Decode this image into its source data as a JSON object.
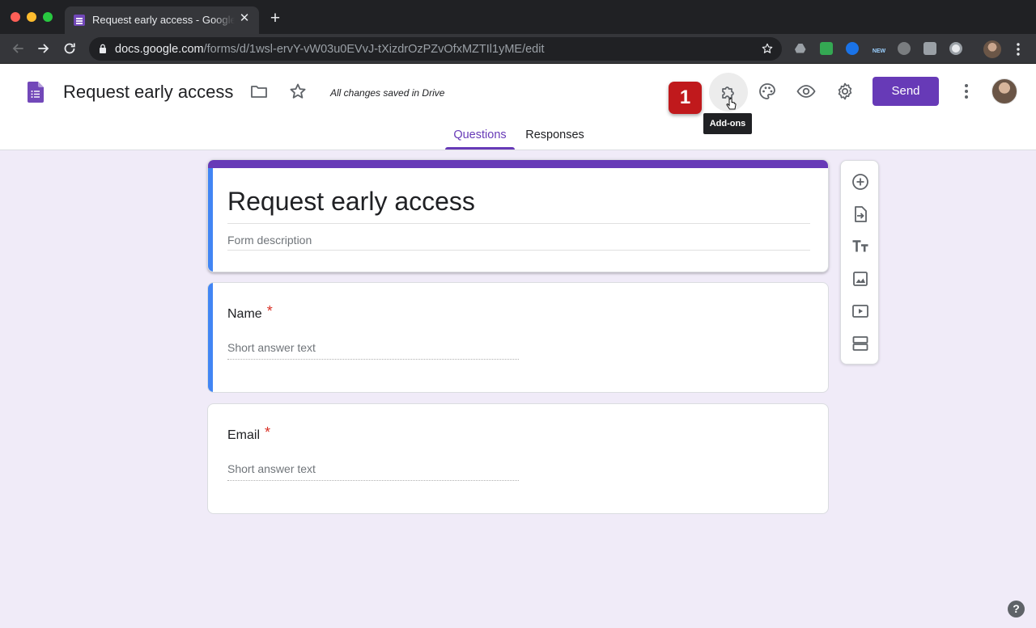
{
  "browser": {
    "tab_title": "Request early access - Google Forms",
    "tab_close_glyph": "✕",
    "new_tab_glyph": "+",
    "url_host": "docs.google.com",
    "url_path": "/forms/d/1wsl-ervY-vW03u0EVvJ-tXizdrOzPZvOfxMZTIl1yME/edit",
    "extension_badge_new": "NEW"
  },
  "header": {
    "doc_title": "Request early access",
    "save_status": "All changes saved in Drive",
    "step_badge": "1",
    "addons_tooltip": "Add-ons",
    "send_label": "Send",
    "tabs": [
      {
        "label": "Questions",
        "active": true
      },
      {
        "label": "Responses",
        "active": false
      }
    ]
  },
  "form": {
    "title": "Request early access",
    "description_placeholder": "Form description",
    "questions": [
      {
        "label": "Name",
        "required_mark": "*",
        "answer_placeholder": "Short answer text"
      },
      {
        "label": "Email",
        "required_mark": "*",
        "answer_placeholder": "Short answer text"
      }
    ]
  },
  "sidebar_tools": [
    "add-question-icon",
    "import-questions-icon",
    "add-title-icon",
    "add-image-icon",
    "add-video-icon",
    "add-section-icon"
  ],
  "help_glyph": "?",
  "colors": {
    "accent": "#673ab7",
    "active_question_bar": "#4285f4",
    "badge": "#c0191c",
    "required": "#d93025",
    "page_background": "#f0ebf8"
  }
}
